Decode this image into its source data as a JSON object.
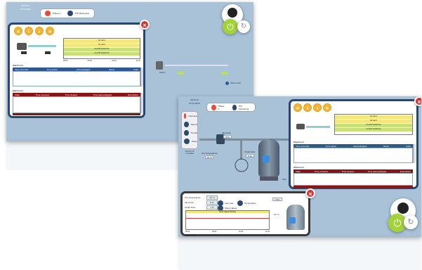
{
  "screen1": {
    "datetime": [
      "09:43:15",
      "07-01-2015"
    ],
    "status_pills": [
      {
        "label": "Phase 1",
        "color": "#e74b3c"
      },
      {
        "label": "PIC Monitoring",
        "color": "#2d4a6e"
      }
    ],
    "chart_bands": [
      "No Alarm",
      "No Alarm",
      "ALARM WARNING",
      "ALARM WARNING"
    ],
    "x_ticks": [
      "08:00",
      "09:00",
      "10:00",
      "11:00"
    ],
    "active_table": {
      "title": "Alarm List",
      "columns": [
        "Time occurred",
        "Time active",
        "Acknowledged",
        "Name",
        "Code"
      ]
    },
    "history_table": {
      "title": "Alarm List",
      "columns": [
        "State",
        "Time occurred",
        "Time cleared",
        "Time acknowledged",
        "Description"
      ]
    },
    "tank_label": "Tank 1",
    "stop_text": "Show more"
  },
  "screen2": {
    "datetime": [
      "09:43:15",
      "07-01-2015"
    ],
    "status_pills": [
      {
        "label": "Phase 1",
        "color": "#e74b3c"
      },
      {
        "label": "PIC Monitoring",
        "color": "#2d4a6e"
      }
    ],
    "menu_items": [
      "Overview",
      "Alarms",
      "Trends",
      "Setup"
    ],
    "menu_footer": [
      "Version 4.0",
      "1:1/1 Data"
    ],
    "process_labels": {
      "inlet_flow": "Inlet Flow",
      "inlet_flow_val": "8 l/s",
      "out_temp": "Out Temperature",
      "out_temp_val": "19 °C",
      "outlet_flow": "Outlet Flow",
      "outlet_flow_val": "8 l/s",
      "inlet": "Inlet",
      "drain": "Drain"
    },
    "chart_bands": [
      "No Alarm",
      "No Alarm",
      "ALARM WARNING",
      "ALARM WARNING"
    ],
    "active_table": {
      "title": "Alarm List",
      "columns": [
        "Time occurred",
        "Time active",
        "Acknowledged",
        "Name",
        "Code"
      ]
    },
    "history_table": {
      "title": "Alarm List",
      "columns": [
        "State",
        "Time occurred",
        "Time cleared",
        "Time acknowledged",
        "Description"
      ]
    }
  },
  "bottom_panel": {
    "rows": [
      {
        "label": "Out Temperature",
        "value": "19 °C"
      },
      {
        "label": "Inlet Flow",
        "value": "8 l/s"
      },
      {
        "label": "Outlet Flow",
        "value": "7 l/s"
      }
    ],
    "toggles": [
      "Flow rate",
      "Temperature",
      "Show values"
    ],
    "chart_title": "Outlet Signal (Filtrate)",
    "x_ticks": [
      "08:00",
      "09:00",
      "10:00",
      "11:00"
    ],
    "tank_value": "12 °C",
    "small_box": "5 l/s",
    "footer": "Alarm List"
  },
  "colors": {
    "accent": "#e74b3c",
    "navy": "#28476f",
    "power_green": "#a5d13a",
    "warning_yellow": "#f6e97a",
    "bg": "#a9c2d8"
  }
}
